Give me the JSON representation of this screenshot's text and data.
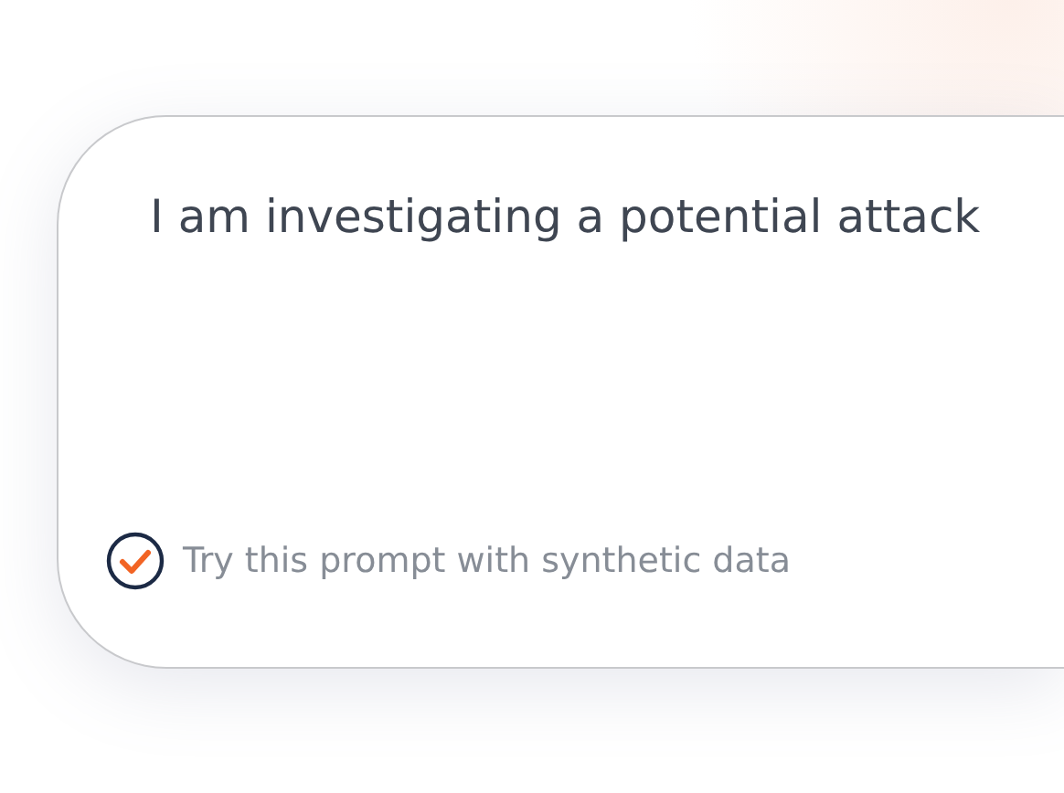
{
  "prompt": {
    "text": "I am investigating a potential attack"
  },
  "synthetic_option": {
    "label": "Try this prompt with synthetic data",
    "checked": true
  }
}
